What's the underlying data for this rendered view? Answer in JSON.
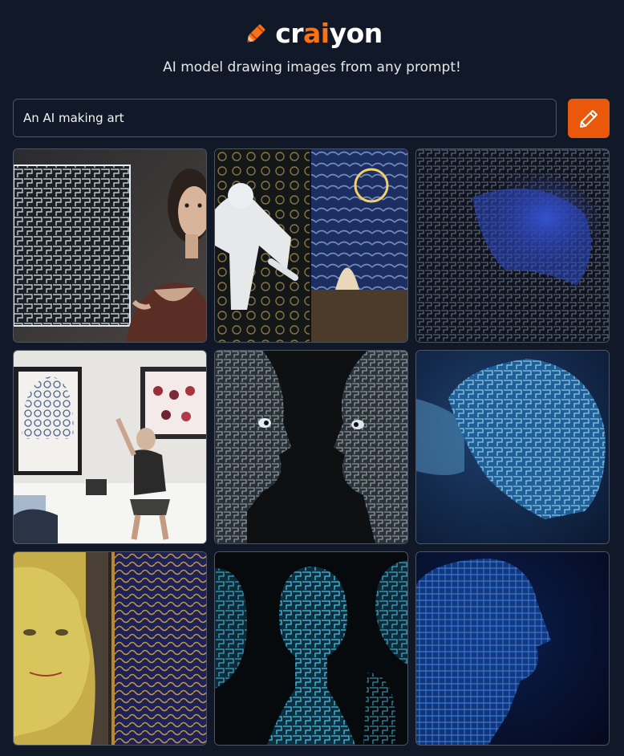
{
  "app": {
    "logo_prefix": "cr",
    "logo_ai": "ai",
    "logo_suffix": "yon",
    "tagline": "AI model drawing images from any prompt!",
    "accent_color": "#f97316",
    "button_color": "#ea580c",
    "background_color": "#111827"
  },
  "prompt": {
    "value": "An AI making art"
  },
  "draw_button": {
    "icon": "pencil-icon"
  },
  "images": [
    {
      "id": 1,
      "subject": "woman beside circuit-maze drawing"
    },
    {
      "id": 2,
      "subject": "white figure and starry night painting"
    },
    {
      "id": 3,
      "subject": "blue circuit head"
    },
    {
      "id": 4,
      "subject": "man in gallery with paintings"
    },
    {
      "id": 5,
      "subject": "two chrome circuit heads facing"
    },
    {
      "id": 6,
      "subject": "blue circuit head profile"
    },
    {
      "id": 7,
      "subject": "gold face and swirling painting"
    },
    {
      "id": 8,
      "subject": "glowing circuit heads"
    },
    {
      "id": 9,
      "subject": "blue wireframe head profile"
    }
  ]
}
